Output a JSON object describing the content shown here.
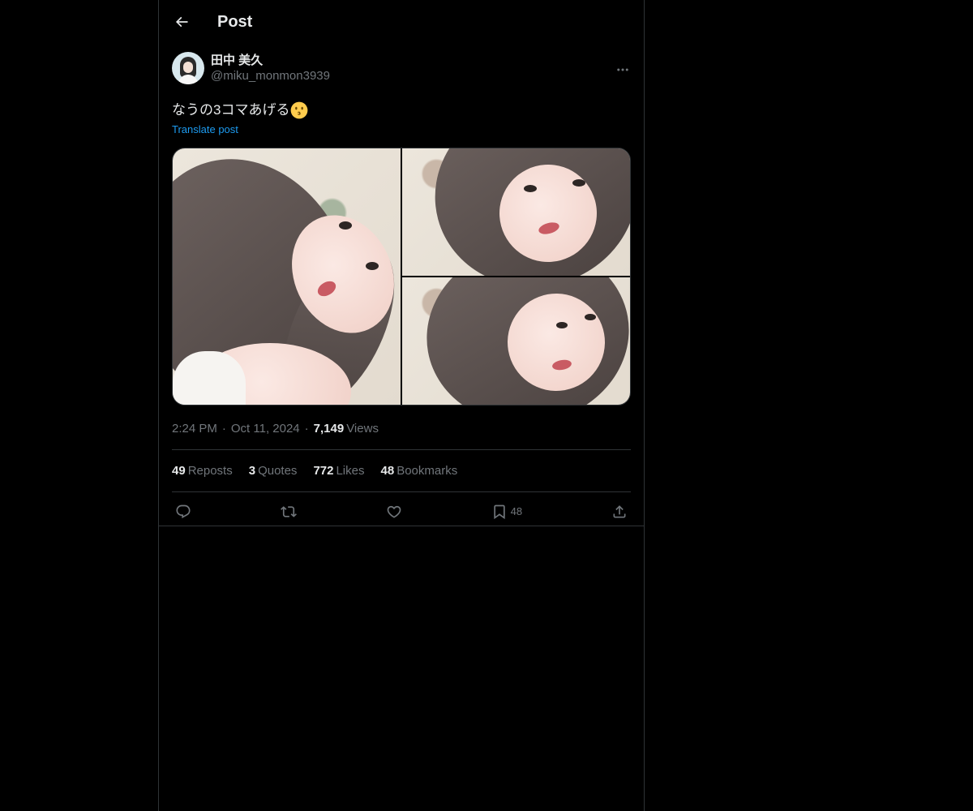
{
  "header": {
    "title": "Post"
  },
  "author": {
    "display_name": "田中 美久",
    "handle": "@miku_monmon3939"
  },
  "post": {
    "text": "なうの3コマあげる",
    "emoji": "kissing-face-emoji",
    "translate_label": "Translate post"
  },
  "meta": {
    "time": "2:24 PM",
    "separator": "·",
    "date": "Oct 11, 2024",
    "views_count": "7,149",
    "views_label": "Views"
  },
  "stats": {
    "reposts_count": "49",
    "reposts_label": "Reposts",
    "quotes_count": "3",
    "quotes_label": "Quotes",
    "likes_count": "772",
    "likes_label": "Likes",
    "bookmarks_count": "48",
    "bookmarks_label": "Bookmarks"
  },
  "actions": {
    "reply_icon": "reply-icon",
    "repost_icon": "repost-icon",
    "like_icon": "heart-icon",
    "bookmark_icon": "bookmark-icon",
    "bookmark_count": "48",
    "share_icon": "share-icon"
  },
  "colors": {
    "background": "#000000",
    "text_primary": "#e7e9ea",
    "text_secondary": "#71767b",
    "accent": "#1d9bf0",
    "border": "#2f3336"
  }
}
